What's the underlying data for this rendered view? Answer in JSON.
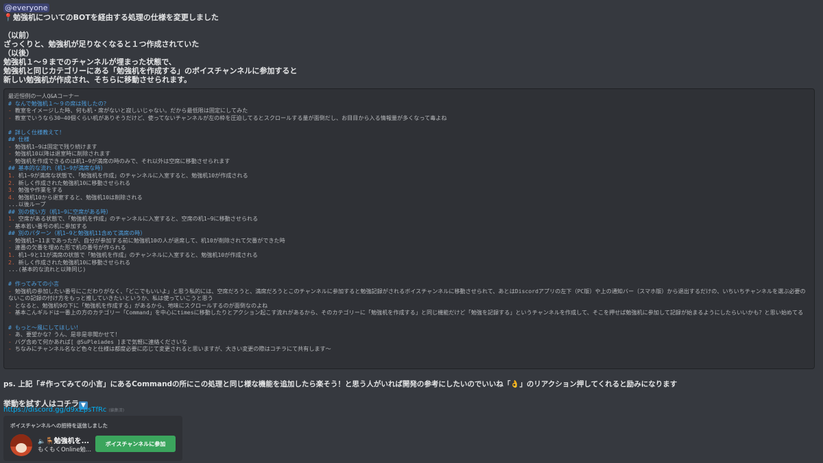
{
  "message": {
    "mention": "@everyone",
    "lines": [
      "勉強机についてのBOTを経由する処理の仕様を変更しました",
      "",
      "（以前）",
      "ざっくりと、勉強机が足りなくなると１つ作成されていた",
      "（以後）",
      "勉強机１～９までのチャンネルが埋まった状態で、",
      "勉強机と同じカテゴリーにある「勉強机を作成する」のボイスチャンネルに参加すると",
      "新しい勉強机が作成され、そちらに移動させられます。"
    ],
    "pin_icon": "pushpin-icon"
  },
  "code": {
    "title": "最近恒例の一人Q&Aコーナー",
    "lines": [
      {
        "t": "h",
        "text": "# なんで勉強机１～９の席は残したの？"
      },
      {
        "t": "b",
        "text": "教室をイメージした時、何も机・席がないと寂しいじゃない。だから最低限は固定にしてみた"
      },
      {
        "t": "b",
        "text": "教室でいうなら30~40個くらい机がありそうだけど、使ってないチャンネルが左の枠を圧迫してるとスクロールする量が面倒だし、お目目から入る情報量が多くなって毒よね"
      },
      {
        "t": "e",
        "text": ""
      },
      {
        "t": "h",
        "text": "# 詳しく仕様教えて！"
      },
      {
        "t": "h",
        "text": "## 仕様"
      },
      {
        "t": "b",
        "text": "勉強机1~9は固定で残り続けます"
      },
      {
        "t": "b",
        "text": "勉強机10以降は退室時に削除されます"
      },
      {
        "t": "b",
        "text": "勉強机を作成できるのは机1~9が満席の時のみで、それ以外は空席に移動させられます"
      },
      {
        "t": "h",
        "text": "## 基本的な流れ（机1~9が満席な時）"
      },
      {
        "t": "n",
        "num": "1.",
        "text": "机1~9が満席な状態で、「勉強机を作成」のチャンネルに入室すると、勉強机10が作成される"
      },
      {
        "t": "n",
        "num": "2.",
        "text": "新しく作成された勉強机10に移動させられる"
      },
      {
        "t": "n",
        "num": "3.",
        "text": "勉強や作業をする"
      },
      {
        "t": "n",
        "num": "4.",
        "text": "勉強机10から退室すると、勉強机10は削除される"
      },
      {
        "t": "p",
        "text": "...以後ループ"
      },
      {
        "t": "h",
        "text": "## 別の使い方（机1~9に空席がある時）"
      },
      {
        "t": "n",
        "num": "1.",
        "text": "空席がある状態で、「勉強机を作成」のチャンネルに入室すると、空席の机1~9に移動させられる"
      },
      {
        "t": "b",
        "text": "基本若い番号の机に参加する"
      },
      {
        "t": "h",
        "text": "## 別のパターン（机1~9と勉強机11含めて満席の時）"
      },
      {
        "t": "b",
        "text": "勉強机1~11まであったが、自分が参加する前に勉強机10の人が退席して、机10が削除されて欠番ができた時"
      },
      {
        "t": "b",
        "text": "連番の欠番を埋めた形で机の番号が作られる"
      },
      {
        "t": "n",
        "num": "1.",
        "text": "机1~9と11が満席の状態で「勉強机を作成」のチャンネルに入室すると、勉強机10が作成される"
      },
      {
        "t": "n",
        "num": "2.",
        "text": "新しく作成された勉強机10に移動させられる"
      },
      {
        "t": "p",
        "text": "...(基本的な流れと以降同じ)"
      },
      {
        "t": "e",
        "text": ""
      },
      {
        "t": "h",
        "text": "# 作ってみての小言"
      },
      {
        "t": "bw",
        "text": "勉強机の参加したい番号にこだわりがなく、「どこでもいいよ」と思う私的には、空席だろうと、満席だろうとこのチャンネルに参加すると勉強記録がされるボイスチャンネルに移動させられて、あとはDiscordアプリの左下（PC版）や上の通知バー（スマホ版）から退出するだけの、いちいちチャンネルを選ぶ必要のないこの記録の付け方をもっと推していきたいというか、私は使っていこうと思う"
      },
      {
        "t": "b",
        "text": "となると、勉強机9の下に「勉強机を作成する」があるから、地味にスクロールするのが面倒なのよね"
      },
      {
        "t": "bw",
        "text": "基本こんギルドは一番上の方のカテゴリー「Command」を中心にtimesに移動したりとアクション起こす流れがあるから、そのカテゴリーに「勉強机を作成する」と同じ機能だけど「勉強を記録する」というチャンネルを作成して、そこを押せば勉強机に参加して記録が始まるようにしたらいいかも？と思い始めてる"
      },
      {
        "t": "e",
        "text": ""
      },
      {
        "t": "h",
        "text": "# もっと〜風にしてほしい！"
      },
      {
        "t": "b",
        "text": "あ、要望かな？うん、是非是非聞かせて！"
      },
      {
        "t": "b",
        "text": "バグ含めて何かあれば[ @SuPleiades ]まで気軽に連絡くださいな"
      },
      {
        "t": "b",
        "text": "ちなみにチャンネル名など色々と仕様は都度必要に応じて変更されると思いますが、大きい変更の際はコチラにて共有します〜"
      }
    ]
  },
  "ps": {
    "before": "ps. 上記「#作ってみての小言」にあるCommandの所にこの処理と同じ様な機能を追加したら楽そう！と思う人がいれば開発の参考にしたいのでいいね「",
    "emoji": "👌",
    "after": "」のリアクション押してくれると励みになります"
  },
  "trial": {
    "text": "挙動を試す人はコチラ",
    "icon": "arrow-down-icon"
  },
  "link": {
    "url": "https://discord.gg/d9xZpsTfRc",
    "edited": "(編集済)"
  },
  "invite": {
    "title": "ボイスチャンネルへの招待を送信しました",
    "channel": "勉強机を...",
    "guild": "もくもくOnline勉...",
    "join": "ボイスチャンネルに参加"
  },
  "colors": {
    "background": "#36393f",
    "code_bg": "#2f3136",
    "heading": "#4fa0e0",
    "bullet": "#d0603c",
    "link": "#00b0f4",
    "join_button": "#3ba55d"
  }
}
